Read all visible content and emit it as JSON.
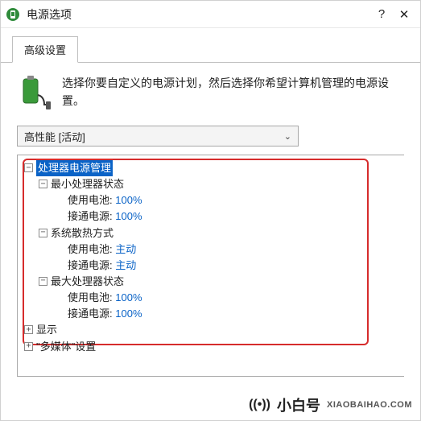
{
  "titlebar": {
    "title": "电源选项",
    "help": "?",
    "close": "✕"
  },
  "tab": {
    "label": "高级设置"
  },
  "message": "选择你要自定义的电源计划，然后选择你希望计算机管理的电源设置。",
  "plan": {
    "selected": "高性能 [活动]"
  },
  "tree": {
    "cpu": {
      "label": "处理器电源管理",
      "min": {
        "label": "最小处理器状态",
        "battery_label": "使用电池:",
        "battery_value": "100%",
        "plugged_label": "接通电源:",
        "plugged_value": "100%"
      },
      "cooling": {
        "label": "系统散热方式",
        "battery_label": "使用电池:",
        "battery_value": "主动",
        "plugged_label": "接通电源:",
        "plugged_value": "主动"
      },
      "max": {
        "label": "最大处理器状态",
        "battery_label": "使用电池:",
        "battery_value": "100%",
        "plugged_label": "接通电源:",
        "plugged_value": "100%"
      }
    },
    "display": {
      "label": "显示"
    },
    "multimedia": {
      "label": "\"多媒体\"设置"
    }
  },
  "watermark": {
    "name": "小白号",
    "url": "XIAOBAIHAO.COM"
  },
  "icons": {
    "minus": "−",
    "plus": "+",
    "chev": "⌄"
  }
}
